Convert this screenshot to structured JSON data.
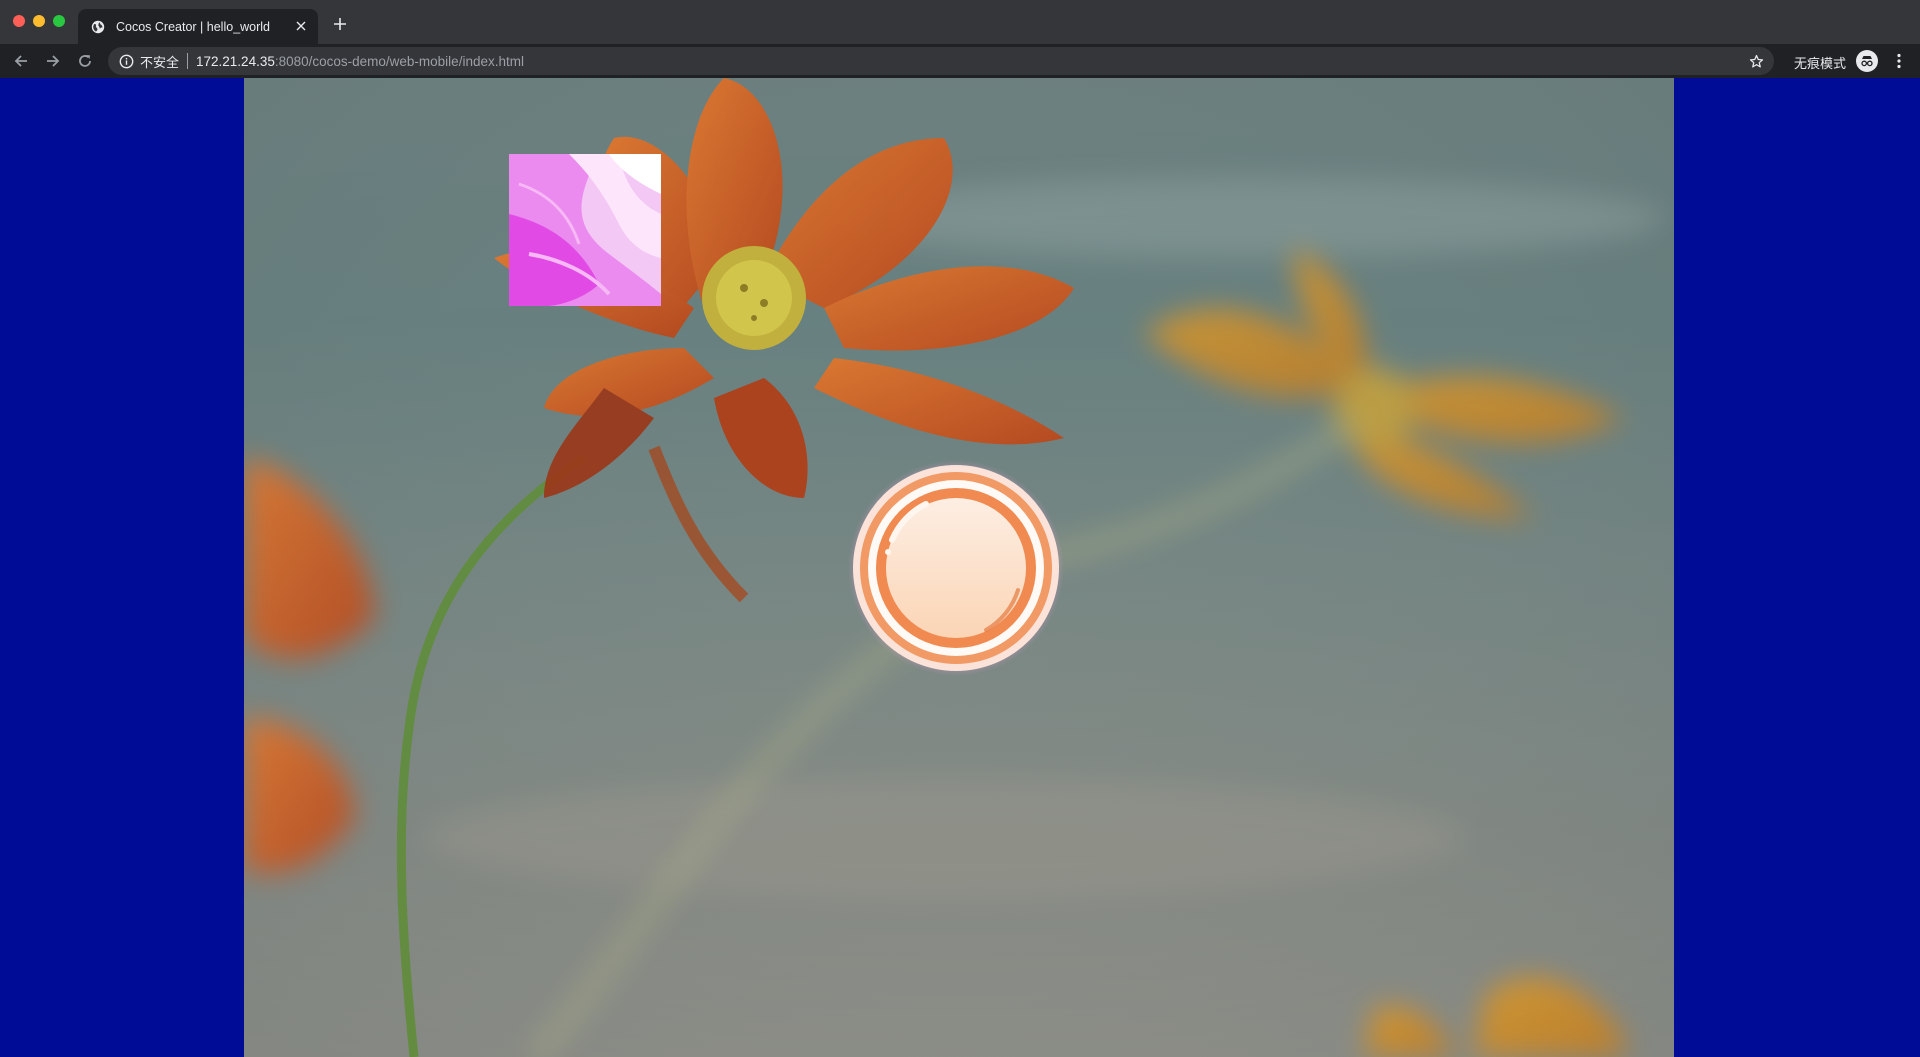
{
  "window": {
    "controls": [
      "close",
      "minimize",
      "maximize"
    ]
  },
  "tab": {
    "title": "Cocos Creator | hello_world",
    "favicon": "globe-icon",
    "close_icon": "close-icon"
  },
  "new_tab_icon": "plus-icon",
  "toolbar": {
    "back_icon": "back-arrow-icon",
    "forward_icon": "forward-arrow-icon",
    "reload_icon": "reload-icon",
    "info_icon": "info-icon",
    "security_label": "不安全",
    "url_host": "172.21.24.35",
    "url_path": ":8080/cocos-demo/web-mobile/index.html",
    "bookmark_icon": "star-icon",
    "incognito_label": "无痕模式",
    "incognito_icon": "incognito-icon",
    "menu_icon": "kebab-menu-icon"
  },
  "page": {
    "background_color": "#000b96",
    "scene": "Cocos Creator web-mobile scene with blurred cosmos flower background, a pink sprite square and a glossy round orange button",
    "accent_colors": {
      "flower": "#c9501f",
      "sprite": "#e24ae6",
      "button_ring": "#f08a50",
      "button_glow": "#f5a0e0"
    }
  }
}
